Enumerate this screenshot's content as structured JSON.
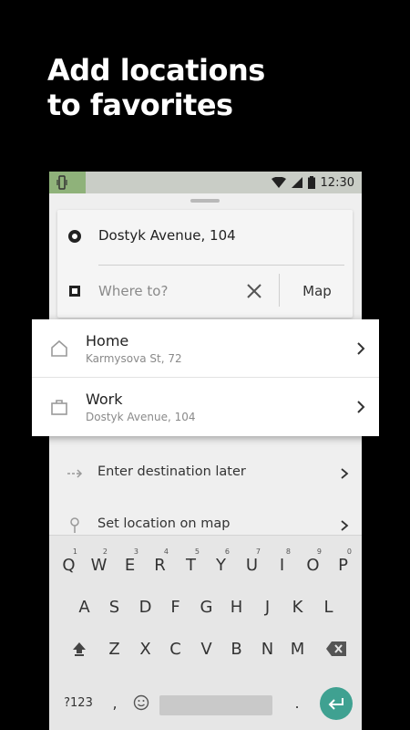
{
  "headline": {
    "line1": "Add locations",
    "line2": "to favorites"
  },
  "status_bar": {
    "time": "12:30"
  },
  "trip": {
    "pickup": "Dostyk Avenue, 104",
    "destination_placeholder": "Where to?",
    "map_label": "Map"
  },
  "favorites": [
    {
      "title": "Home",
      "subtitle": "Karmysova St, 72",
      "icon": "home-icon"
    },
    {
      "title": "Work",
      "subtitle": "Dostyk Avenue, 104",
      "icon": "briefcase-icon"
    }
  ],
  "options": {
    "later": "Enter destination later",
    "set_on_map": "Set location on map"
  },
  "keyboard": {
    "row1": [
      {
        "k": "Q",
        "h": "1"
      },
      {
        "k": "W",
        "h": "2"
      },
      {
        "k": "E",
        "h": "3"
      },
      {
        "k": "R",
        "h": "4"
      },
      {
        "k": "T",
        "h": "5"
      },
      {
        "k": "Y",
        "h": "6"
      },
      {
        "k": "U",
        "h": "7"
      },
      {
        "k": "I",
        "h": "8"
      },
      {
        "k": "O",
        "h": "9"
      },
      {
        "k": "P",
        "h": "0"
      }
    ],
    "row2": [
      "A",
      "S",
      "D",
      "F",
      "G",
      "H",
      "J",
      "K",
      "L"
    ],
    "row3": [
      "Z",
      "X",
      "C",
      "V",
      "B",
      "N",
      "M"
    ],
    "symbols_label": "?123",
    "comma": ",",
    "period": "."
  },
  "colors": {
    "accent": "#3fa191",
    "headline": "#ffffff",
    "background": "#000000"
  }
}
